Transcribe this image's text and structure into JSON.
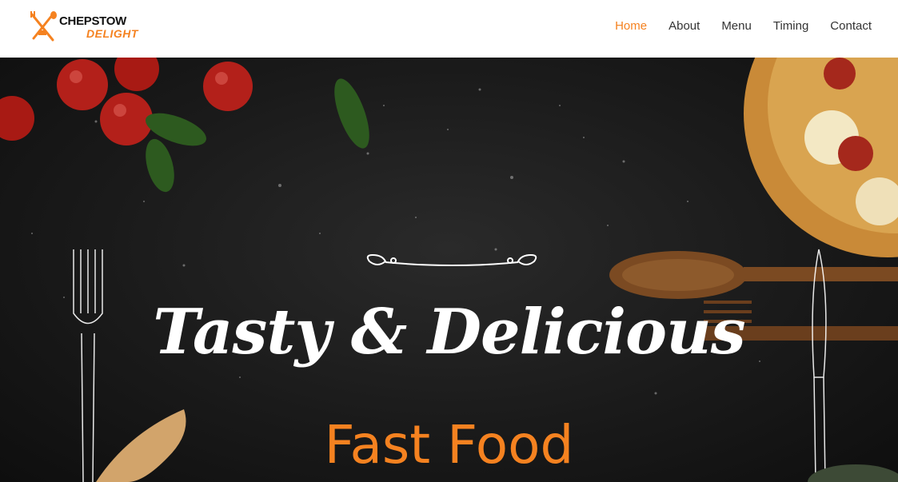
{
  "brand": {
    "name_top": "CHEPSTOW",
    "name_bottom": "DELIGHT"
  },
  "nav": {
    "items": [
      {
        "label": "Home",
        "active": true
      },
      {
        "label": "About",
        "active": false
      },
      {
        "label": "Menu",
        "active": false
      },
      {
        "label": "Timing",
        "active": false
      },
      {
        "label": "Contact",
        "active": false
      }
    ]
  },
  "hero": {
    "headline": "Tasty & Delicious",
    "subline": "Fast Food"
  },
  "colors": {
    "accent": "#f58220",
    "dark_bg": "#1a1a1a",
    "white": "#ffffff"
  }
}
